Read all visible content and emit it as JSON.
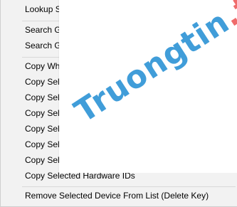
{
  "menu": {
    "items": [
      {
        "label": "Lookup S"
      },
      {
        "label": "Search Go"
      },
      {
        "label": "Search Go"
      },
      {
        "label": "Copy Wh"
      },
      {
        "label": "Copy Sele"
      },
      {
        "label": "Copy Sele"
      },
      {
        "label": "Copy Sele"
      },
      {
        "label": "Copy Sele"
      },
      {
        "label": "Copy Sele"
      },
      {
        "label": "Copy Sele"
      },
      {
        "label": "Copy Selected Hardware IDs"
      },
      {
        "label": "Remove Selected Device From List (Delete Key)"
      }
    ]
  },
  "watermark": {
    "main": "Truongtin",
    "tld": ".top"
  }
}
